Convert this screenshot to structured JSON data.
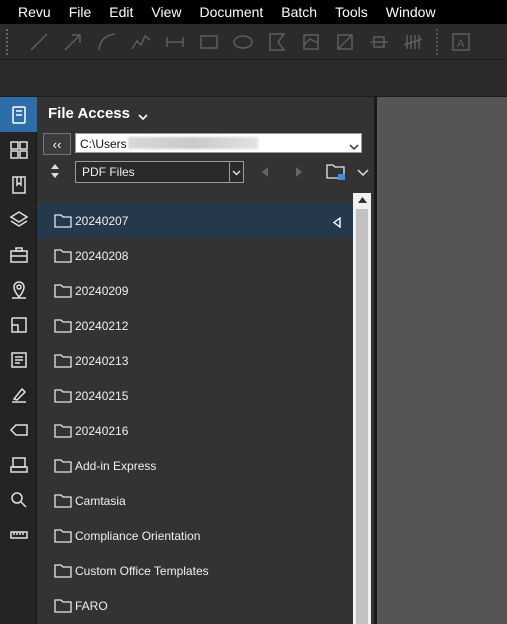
{
  "menu": [
    {
      "label": "Revu"
    },
    {
      "label": "File"
    },
    {
      "label": "Edit"
    },
    {
      "label": "View"
    },
    {
      "label": "Document"
    },
    {
      "label": "Batch"
    },
    {
      "label": "Tools"
    },
    {
      "label": "Window"
    }
  ],
  "toolbar_icons": [
    "line-icon",
    "arrow-icon",
    "arc-icon",
    "polyline-icon",
    "dimension-icon",
    "rectangle-icon",
    "ellipse-icon",
    "polygon-icon",
    "area-measure-icon",
    "perimeter-icon",
    "length-measure-icon",
    "count-icon",
    "text-box-icon"
  ],
  "sidebar_icons": [
    "file-access-icon",
    "thumbnails-icon",
    "bookmarks-icon",
    "layers-icon",
    "toolchest-icon",
    "places-icon",
    "spaces-icon",
    "markups-list-icon",
    "signatures-icon",
    "tags-icon",
    "studio-icon",
    "search-icon",
    "measurements-icon"
  ],
  "panel": {
    "title": "File Access",
    "back_label": "‹‹",
    "path_value": "C:\\Users",
    "filter_value": "PDF Files"
  },
  "files": [
    {
      "name": "20240207",
      "selected": true
    },
    {
      "name": "20240208"
    },
    {
      "name": "20240209"
    },
    {
      "name": "20240212"
    },
    {
      "name": "20240213"
    },
    {
      "name": "20240215"
    },
    {
      "name": "20240216"
    },
    {
      "name": "Add-in Express"
    },
    {
      "name": "Camtasia"
    },
    {
      "name": "Compliance Orientation"
    },
    {
      "name": "Custom Office Templates"
    },
    {
      "name": "FARO"
    }
  ],
  "colors": {
    "selection": "#26394c",
    "active_sidebar": "#2d6ea8",
    "folder_accent": "#3a8ee6"
  }
}
